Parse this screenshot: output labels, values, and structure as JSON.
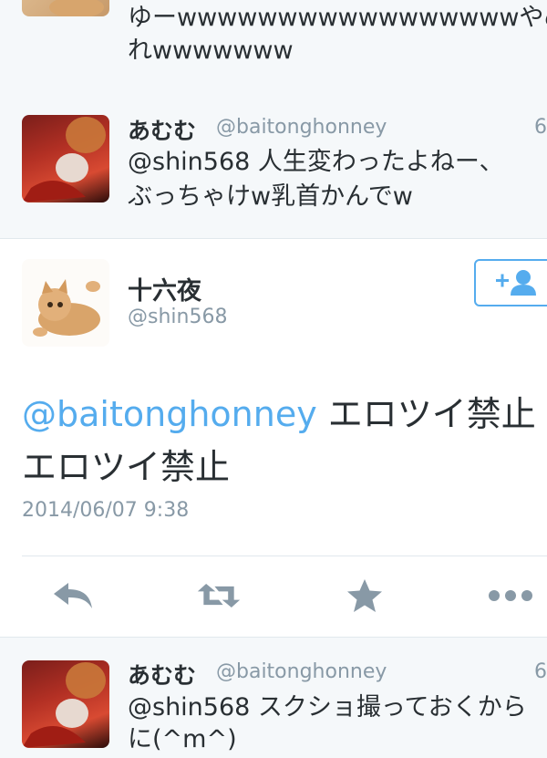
{
  "tweets_above": [
    {
      "text_lines": [
        "ゆーwwwwwwwwwwwwwwwwwやめ",
        "れwwwwwww"
      ]
    },
    {
      "name": "あむむ",
      "handle": "@baitonghonney",
      "time": "6",
      "text_lines": [
        "@shin568 人生変わったよねー、",
        "ぶっちゃけw乳首かんでw"
      ]
    }
  ],
  "focused_tweet": {
    "name": "十六夜",
    "handle": "@shin568",
    "mention": "@baitonghonney",
    "text_rest": " エロツイ禁止",
    "text_line2": "エロツイ禁止",
    "timestamp": "2014/06/07 9:38",
    "actions": [
      "reply-icon",
      "retweet-icon",
      "favorite-icon",
      "more-icon"
    ],
    "follow_icon": "add-user-icon"
  },
  "tweets_below": [
    {
      "name": "あむむ",
      "handle": "@baitonghonney",
      "time": "6",
      "text_lines": [
        "@shin568 スクショ撮っておくから",
        "に(^m^)"
      ]
    }
  ],
  "colors": {
    "accent": "#55acee",
    "text": "#292f33",
    "muted": "#8899a6",
    "icon": "#8899a6",
    "background": "#f5f8fa",
    "divider": "#e1e8ed"
  }
}
